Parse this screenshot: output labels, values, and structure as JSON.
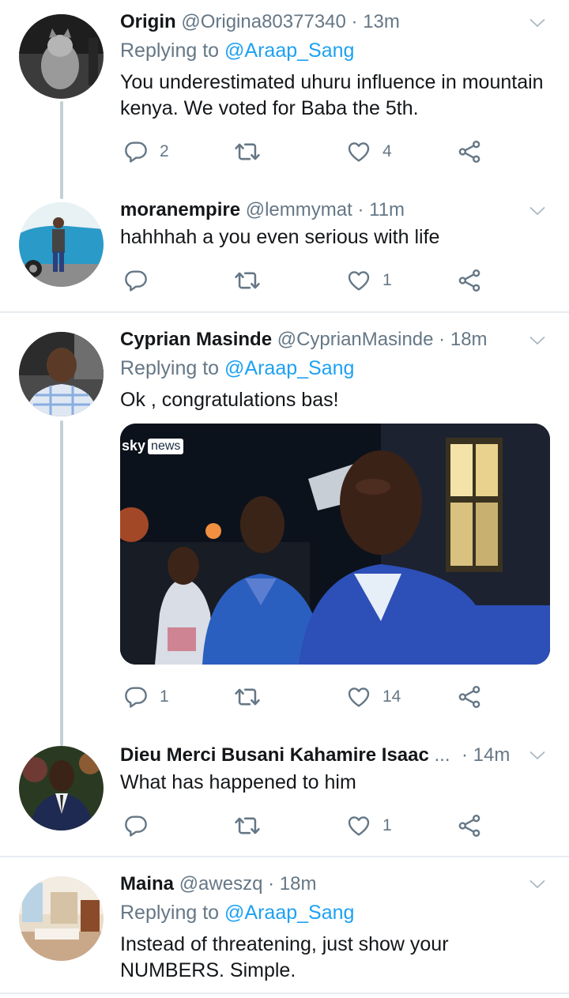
{
  "tweets": [
    {
      "name": "Origin",
      "handle": "@Origina80377340",
      "sep": "·",
      "time": "13m",
      "replying_prefix": "Replying to ",
      "replying_to": "@Araap_Sang",
      "text": "You underestimated uhuru influence in mountain kenya. We voted for Baba the 5th.",
      "replies": "2",
      "retweets": "",
      "likes": "4"
    },
    {
      "name": "moranempire",
      "handle": "@lemmymat",
      "sep": "·",
      "time": "11m",
      "text": "hahhhah a you even serious with life",
      "replies": "",
      "retweets": "",
      "likes": "1"
    },
    {
      "name": "Cyprian Masinde",
      "handle": "@CyprianMasinde",
      "sep": "·",
      "time": "18m",
      "replying_prefix": "Replying to ",
      "replying_to": "@Araap_Sang",
      "text": "Ok , congratulations bas!",
      "media_badge_sky": "sky",
      "media_badge_news": "news",
      "replies": "1",
      "retweets": "",
      "likes": "14"
    },
    {
      "name": "Dieu Merci Busani Kahamire Isaac",
      "ellipsis": "...",
      "sep": "·",
      "time": "14m",
      "text": "What has happened to him",
      "replies": "",
      "retweets": "",
      "likes": "1"
    },
    {
      "name": "Maina",
      "handle": "@aweszq",
      "sep": "·",
      "time": "18m",
      "replying_prefix": "Replying to ",
      "replying_to": "@Araap_Sang",
      "text": "Instead of threatening, just show your NUMBERS. Simple."
    }
  ],
  "colors": {
    "accent": "#1da1f2",
    "muted": "#657786",
    "text": "#14171a",
    "divider": "#e6ecf0",
    "thread": "#c4cfd6"
  },
  "icons": {
    "reply": "reply-icon",
    "retweet": "retweet-icon",
    "like": "like-icon",
    "share": "share-icon",
    "more": "chevron-down-icon"
  }
}
